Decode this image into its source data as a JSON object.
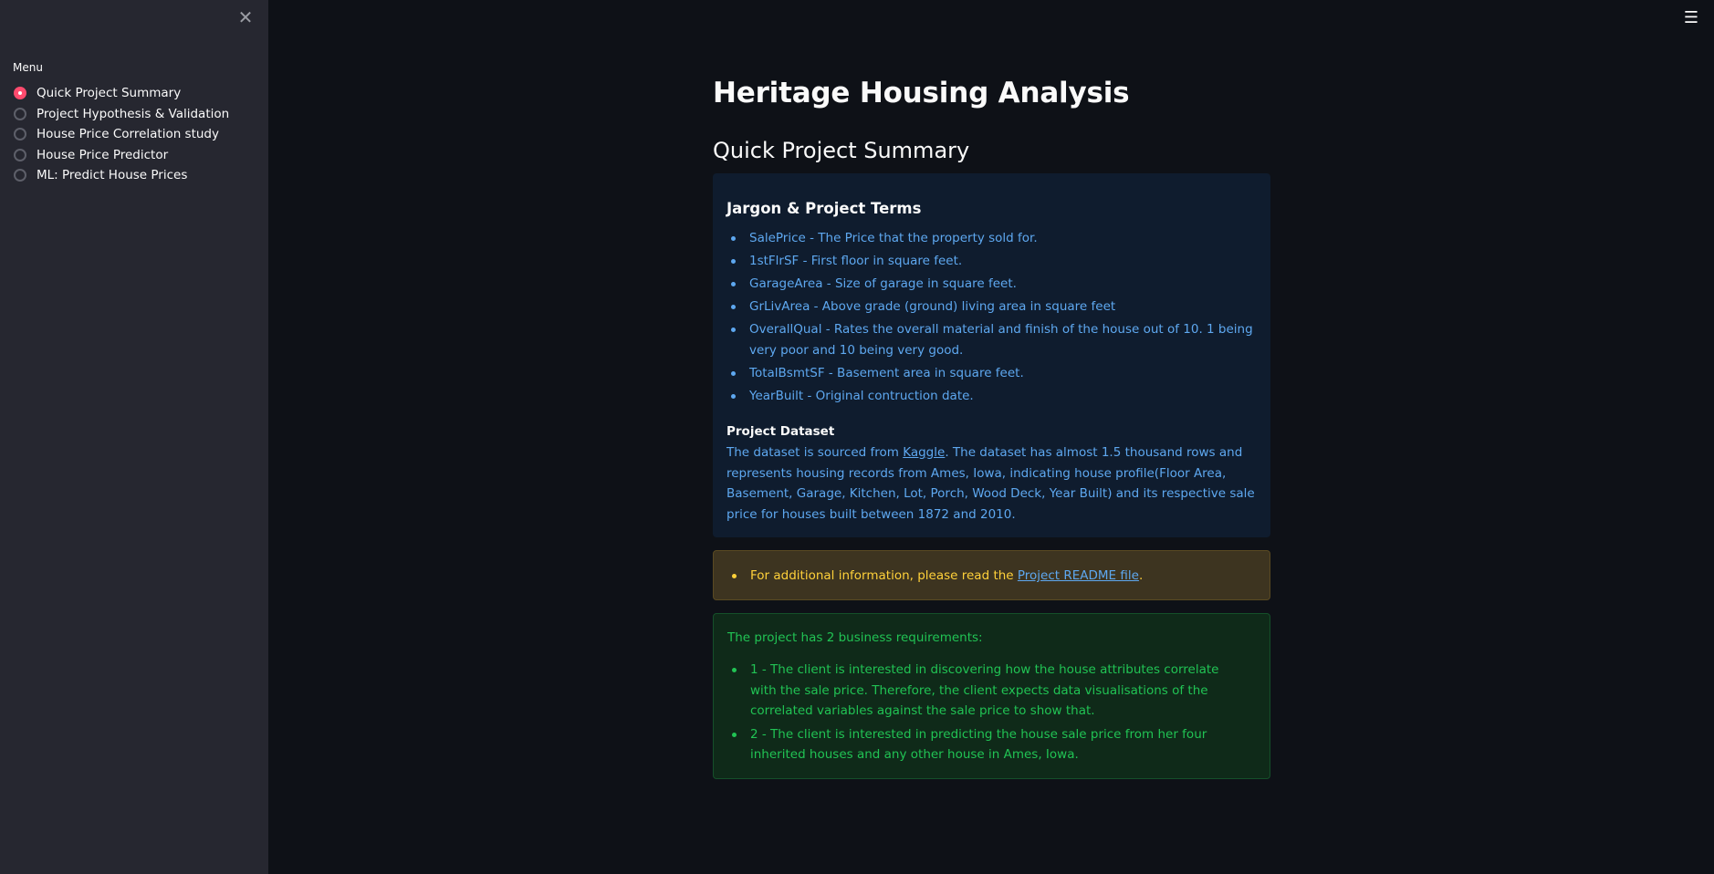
{
  "sidebar": {
    "close_icon": "✕",
    "menu_label": "Menu",
    "items": [
      {
        "label": "Quick Project Summary",
        "selected": true
      },
      {
        "label": "Project Hypothesis & Validation",
        "selected": false
      },
      {
        "label": "House Price Correlation study",
        "selected": false
      },
      {
        "label": "House Price Predictor",
        "selected": false
      },
      {
        "label": "ML: Predict House Prices",
        "selected": false
      }
    ]
  },
  "header": {
    "hamburger_icon": "☰"
  },
  "main": {
    "title": "Heritage Housing Analysis",
    "section_title": "Quick Project Summary",
    "info": {
      "subheader": "Jargon & Project Terms",
      "terms": [
        "SalePrice - The Price that the property sold for.",
        "1stFlrSF - First floor in square feet.",
        "GarageArea - Size of garage in square feet.",
        "GrLivArea - Above grade (ground) living area in square feet",
        "OverallQual - Rates the overall material and finish of the house out of 10. 1 being very poor and 10 being very good.",
        "TotalBsmtSF - Basement area in square feet.",
        "YearBuilt - Original contruction date."
      ],
      "dataset_title": "Project Dataset",
      "dataset_text_before": "The dataset is sourced from ",
      "dataset_link": "Kaggle",
      "dataset_text_after": ". The dataset has almost 1.5 thousand rows and represents housing records from Ames, Iowa, indicating house profile(Floor Area, Basement, Garage, Kitchen, Lot, Porch, Wood Deck, Year Built) and its respective sale price for houses built between 1872 and 2010."
    },
    "warning": {
      "text_before": "For additional information, please read the ",
      "link": "Project README file",
      "text_after": "."
    },
    "success": {
      "intro": "The project has 2 business requirements:",
      "requirements": [
        "1 - The client is interested in discovering how the house attributes correlate with the sale price. Therefore, the client expects data visualisations of the correlated variables against the sale price to show that.",
        "2 - The client is interested in predicting the house sale price from her four inherited houses and any other house in Ames, Iowa."
      ]
    }
  },
  "colors": {
    "background": "#0e1117",
    "sidebar": "#262730",
    "accent": "#ff4b6e",
    "info_text": "#5ea8f0",
    "warning_text": "#ffd13a",
    "success_text": "#21c354"
  }
}
